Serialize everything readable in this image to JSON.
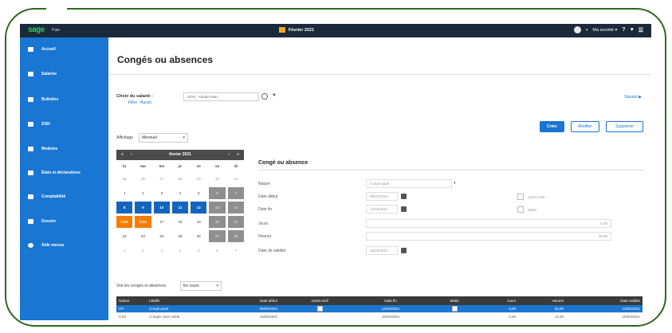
{
  "topbar": {
    "logo": "sage",
    "product": "Paie",
    "period": "Février 2021",
    "company": "Ma société",
    "company_arrow": "▾",
    "help_icon": "?",
    "menu_icon": "☰"
  },
  "sidebar": {
    "items": [
      {
        "label": "Accueil"
      },
      {
        "label": "Salariés"
      },
      {
        "label": "Bulletins"
      },
      {
        "label": "DSN"
      },
      {
        "label": "Modules"
      },
      {
        "label": "États et déclarations"
      },
      {
        "label": "Comptabilité"
      },
      {
        "label": "Dossier"
      },
      {
        "label": "Aide menus"
      }
    ]
  },
  "page": {
    "title": "Congés ou absences",
    "employee_label": "Choix du salarié :",
    "filter_label": "Filtre : Aucun",
    "employee_value": "0029 - Abadie Marc",
    "next_label": "Suivant ▶",
    "buttons": {
      "create": "Créer",
      "modify": "Modifier",
      "delete": "Supprimer"
    },
    "display_label": "Affichage",
    "display_value": "Mensuel",
    "list_label": "Voir les congés et absences",
    "list_value": "En cours"
  },
  "calendar": {
    "month": "février 2021",
    "nav_prev2": "«",
    "nav_prev": "‹",
    "nav_next": "›",
    "nav_next2": "»",
    "dow": [
      "lu",
      "ma",
      "me",
      "je",
      "ve",
      "sa",
      "di"
    ],
    "weeks": [
      [
        {
          "d": "25",
          "t": "other"
        },
        {
          "d": "26",
          "t": "other"
        },
        {
          "d": "27",
          "t": "other"
        },
        {
          "d": "28",
          "t": "other"
        },
        {
          "d": "29",
          "t": "other"
        },
        {
          "d": "30",
          "t": "other"
        },
        {
          "d": "31",
          "t": "other"
        }
      ],
      [
        {
          "d": "1",
          "t": ""
        },
        {
          "d": "2",
          "t": ""
        },
        {
          "d": "3",
          "t": ""
        },
        {
          "d": "4",
          "t": ""
        },
        {
          "d": "5",
          "t": ""
        },
        {
          "d": "6",
          "t": "weekend"
        },
        {
          "d": "7",
          "t": "weekend"
        }
      ],
      [
        {
          "d": "8",
          "t": "cp"
        },
        {
          "d": "9",
          "t": "cp"
        },
        {
          "d": "10",
          "t": "cp"
        },
        {
          "d": "11",
          "t": "cp"
        },
        {
          "d": "12",
          "t": "cp"
        },
        {
          "d": "13",
          "t": "weekend"
        },
        {
          "d": "14",
          "t": "weekend"
        }
      ],
      [
        {
          "d": "CSS",
          "t": "css"
        },
        {
          "d": "CSS",
          "t": "css"
        },
        {
          "d": "17",
          "t": ""
        },
        {
          "d": "18",
          "t": ""
        },
        {
          "d": "19",
          "t": ""
        },
        {
          "d": "20",
          "t": "weekend"
        },
        {
          "d": "21",
          "t": "weekend"
        }
      ],
      [
        {
          "d": "22",
          "t": ""
        },
        {
          "d": "23",
          "t": ""
        },
        {
          "d": "24",
          "t": ""
        },
        {
          "d": "25",
          "t": ""
        },
        {
          "d": "26",
          "t": ""
        },
        {
          "d": "27",
          "t": "weekend"
        },
        {
          "d": "28",
          "t": "weekend"
        }
      ],
      [
        {
          "d": "1",
          "t": "other"
        },
        {
          "d": "2",
          "t": "other"
        },
        {
          "d": "3",
          "t": "other"
        },
        {
          "d": "4",
          "t": "other"
        },
        {
          "d": "5",
          "t": "other"
        },
        {
          "d": "6",
          "t": "other"
        },
        {
          "d": "7",
          "t": "other"
        }
      ]
    ]
  },
  "form": {
    "title": "Congé ou absence",
    "nature_label": "Nature",
    "nature_value": "Congé payé",
    "start_label": "Date début",
    "start_value": "08/02/2021",
    "end_label": "Date fin",
    "end_value": "12/02/2021",
    "days_label": "Jours",
    "days_value": "5,00",
    "hours_label": "Heures",
    "hours_value": "35,00",
    "validity_label": "Date de validité",
    "validity_value": "12/02/2021",
    "afternoon_label": "Après-midi",
    "morning_label": "Matin"
  },
  "table": {
    "headers": [
      "Nature",
      "Libellé",
      "Date début",
      "Après-midi",
      "Date fin",
      "Matin",
      "Jours",
      "Heures",
      "Date validité"
    ],
    "rows": [
      [
        "CP",
        "Congé payé",
        "08/02/2021",
        "",
        "12/02/2021",
        "",
        "5,00",
        "35,00",
        "12/02/2021"
      ],
      [
        "CSS",
        "Congés sans solde",
        "15/02/2021",
        "",
        "16/02/2021",
        "",
        "2,00",
        "14,00",
        "16/02/2021"
      ]
    ]
  },
  "colors": {
    "accent": "#1976d2",
    "topbar": "#1a2a3a",
    "cp_day": "#1565c0",
    "css_day": "#f57c00",
    "weekend": "#8f8f8f",
    "frame": "#2d6a1e"
  }
}
